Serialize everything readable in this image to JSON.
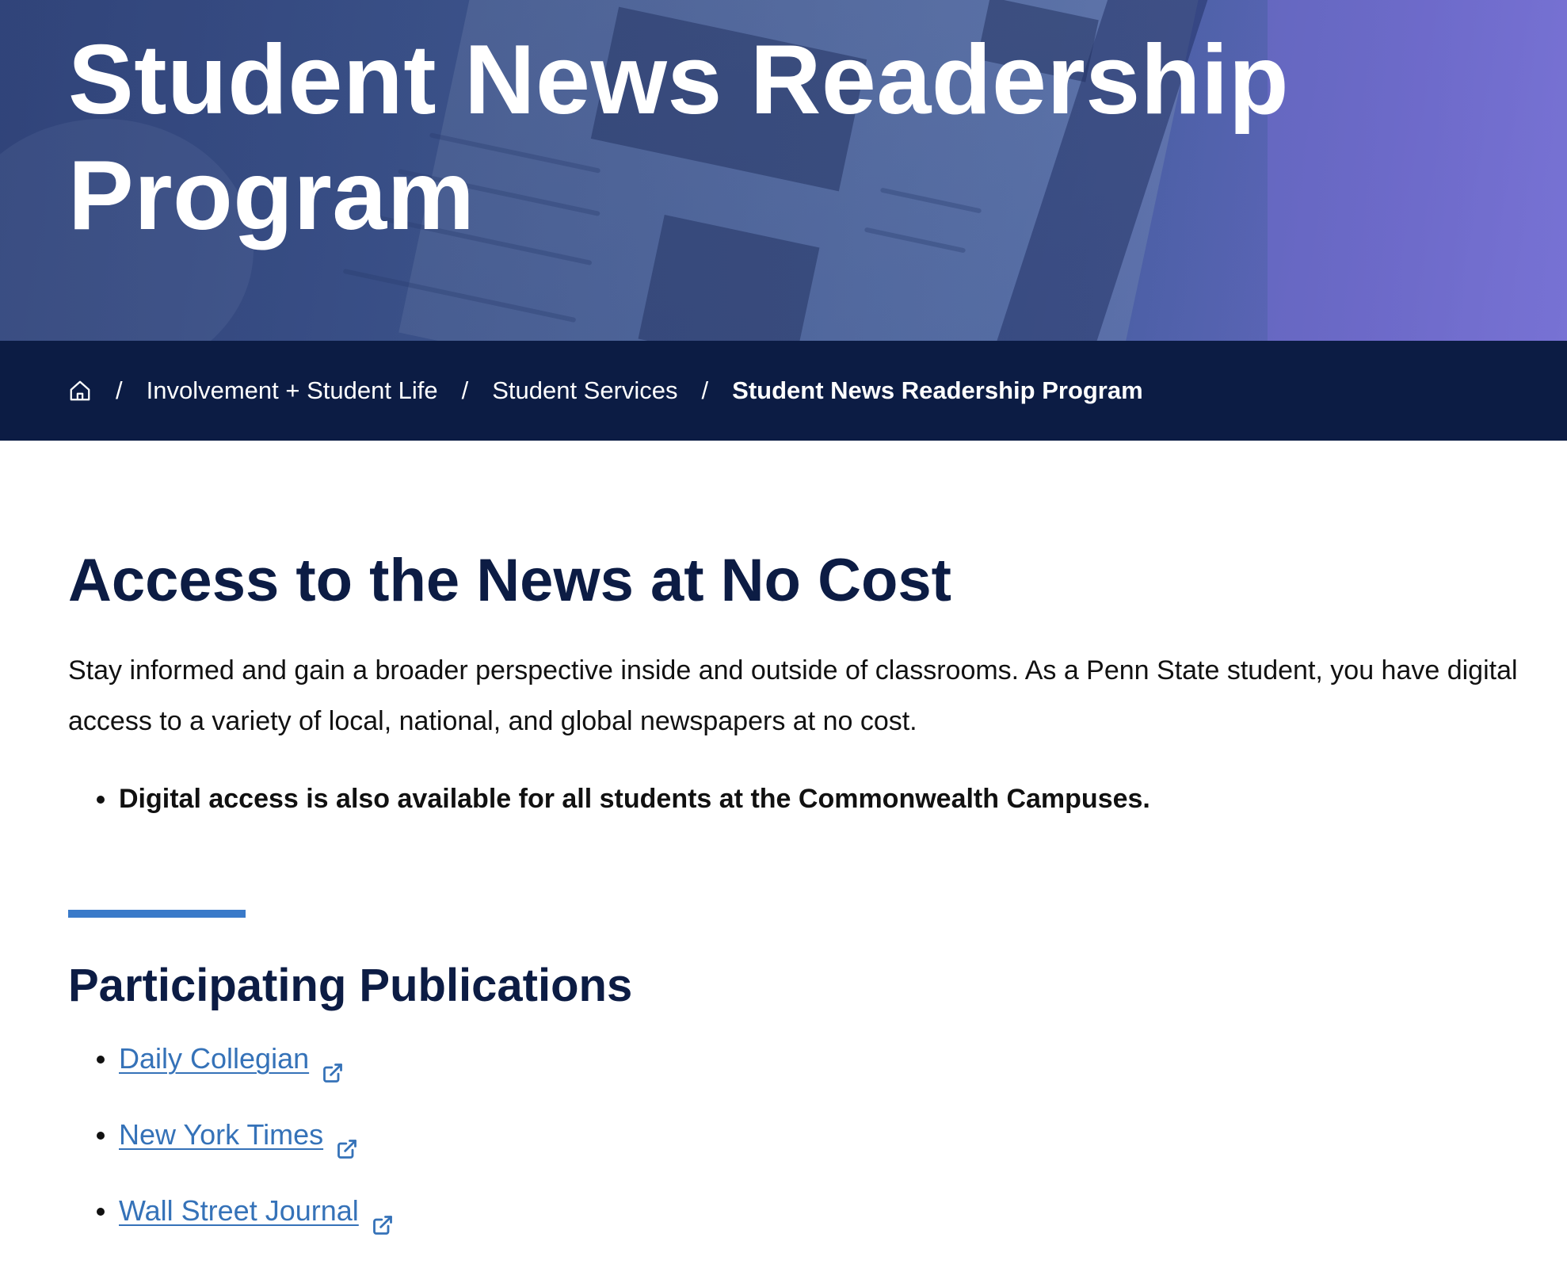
{
  "hero": {
    "title": "Student News Readership Program"
  },
  "breadcrumb": {
    "home_icon": "home-icon",
    "separator": "/",
    "items": [
      {
        "label": "Involvement + Student Life"
      },
      {
        "label": "Student Services"
      }
    ],
    "current": "Student News Readership Program"
  },
  "main": {
    "heading": "Access to the News at No Cost",
    "intro": "Stay informed and gain a broader perspective inside and outside of classrooms. As a Penn State student, you have digital access to a variety of local, national, and global newspapers at no cost.",
    "bullets": [
      "Digital access is also available for all students at the Commonwealth Campuses."
    ],
    "publications_heading": "Participating Publications",
    "publications": [
      {
        "label": "Daily Collegian",
        "icon": "external-link-icon"
      },
      {
        "label": "New York Times",
        "icon": "external-link-icon"
      },
      {
        "label": "Wall Street Journal",
        "icon": "external-link-icon"
      }
    ]
  },
  "colors": {
    "navy": "#0c1c44",
    "link_blue": "#3572b8",
    "accent_rule": "#3a7ac9"
  }
}
